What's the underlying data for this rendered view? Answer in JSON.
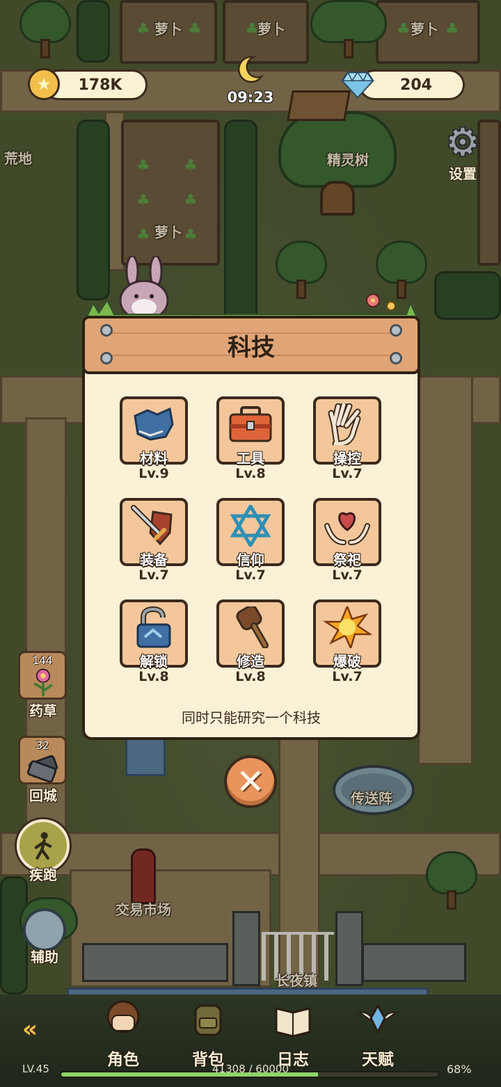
{
  "hud": {
    "coins": "178K",
    "gems": "204",
    "time": "09:23",
    "settings_label": "设置"
  },
  "map_labels": {
    "carrot_1": "萝卜",
    "carrot_2": "萝卜",
    "carrot_3": "萝卜",
    "carrot_4": "萝卜",
    "wasteland": "荒地",
    "spirit_tree": "精灵树",
    "teleport": "传送阵",
    "market": "交易市场",
    "town": "长夜镇"
  },
  "side_buttons": {
    "herb_count": "144",
    "herb_label": "药草",
    "return_count": "32",
    "return_label": "回城",
    "sprint_label": "疾跑",
    "assist_label": "辅助"
  },
  "tech_modal": {
    "title": "科技",
    "note": "同时只能研究一个科技",
    "items": [
      {
        "name": "材料",
        "level": "Lv.9",
        "icon": "material-icon"
      },
      {
        "name": "工具",
        "level": "Lv.8",
        "icon": "toolbox-icon"
      },
      {
        "name": "操控",
        "level": "Lv.7",
        "icon": "hand-icon"
      },
      {
        "name": "装备",
        "level": "Lv.7",
        "icon": "sword-shield-icon"
      },
      {
        "name": "信仰",
        "level": "Lv.7",
        "icon": "hexagram-icon"
      },
      {
        "name": "祭祀",
        "level": "Lv.7",
        "icon": "offering-heart-icon"
      },
      {
        "name": "解锁",
        "level": "Lv.8",
        "icon": "padlock-icon"
      },
      {
        "name": "修造",
        "level": "Lv.8",
        "icon": "mallet-icon"
      },
      {
        "name": "爆破",
        "level": "Lv.7",
        "icon": "explosion-icon"
      }
    ]
  },
  "bottom_nav": {
    "character": "角色",
    "backpack": "背包",
    "journal": "日志",
    "talent": "天赋"
  },
  "player": {
    "level": "LV.45",
    "xp": "41308 / 60000",
    "progress_pct": "68%",
    "progress_fraction": 0.68
  },
  "colors": {
    "panel": "#fbf1d6",
    "header_wood": "#e0a577",
    "tile": "#f3c79b",
    "close_button": "#e9935d",
    "xp_fill": "#8fd36b"
  }
}
